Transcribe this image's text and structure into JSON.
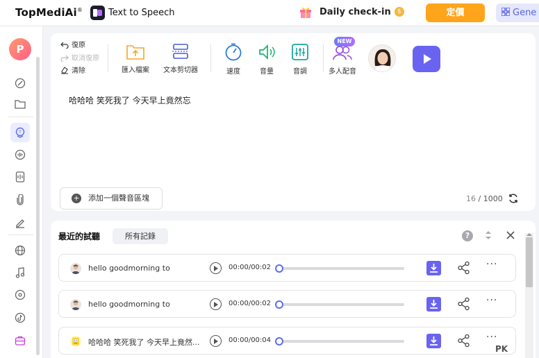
{
  "header": {
    "brand": "TopMediAi",
    "brand_mark": "®",
    "app_name": "Text to Speech",
    "checkin_label": "Daily check-in",
    "coin_symbol": "$",
    "pricing_label": "定價",
    "generate_label": "Gene"
  },
  "sidebar": {
    "avatar_letter": "P",
    "items": [
      {
        "icon": "magic-pen-icon"
      },
      {
        "icon": "folder-icon"
      },
      {
        "icon": "tts-voice-icon",
        "active": true
      },
      {
        "icon": "voice-wave-icon"
      },
      {
        "icon": "document-audio-icon"
      },
      {
        "icon": "paperclip-icon"
      },
      {
        "icon": "pen-edit-icon"
      },
      {
        "icon": "globe-icon"
      },
      {
        "icon": "music-note-icon"
      },
      {
        "icon": "vinyl-icon"
      },
      {
        "icon": "tiktok-icon"
      },
      {
        "icon": "toolbox-icon"
      }
    ]
  },
  "editor": {
    "undo_label": "復原",
    "redo_label": "取消復原",
    "clear_label": "清除",
    "tools": {
      "import_label": "匯入檔案",
      "splitter_label": "文本剪切器",
      "speed_label": "速度",
      "volume_label": "音量",
      "pitch_label": "音調",
      "multi_voice_label": "多人配音",
      "new_badge": "NEW"
    },
    "text": "哈哈哈 笑死我了 今天早上竟然忘",
    "add_block_label": "添加一個聲音區塊",
    "char_count": "16",
    "char_limit": "/ 1000",
    "accent": "#6a63f2"
  },
  "recent": {
    "title": "最近的試聽",
    "all_records_label": "所有記錄",
    "help_symbol": "?",
    "rows": [
      {
        "text": "hello goodmorning to",
        "time": "00:00/00:02",
        "avatar": "man-avatar",
        "progress": 0
      },
      {
        "text": "hello goodmorning to",
        "time": "00:00/00:02",
        "avatar": "man-avatar",
        "progress": 0
      },
      {
        "text": "哈哈哈 笑死我了 今天早上竟然...",
        "time": "00:00/00:04",
        "avatar": "sponge-avatar",
        "progress": 0
      }
    ]
  },
  "watermark": "PK"
}
